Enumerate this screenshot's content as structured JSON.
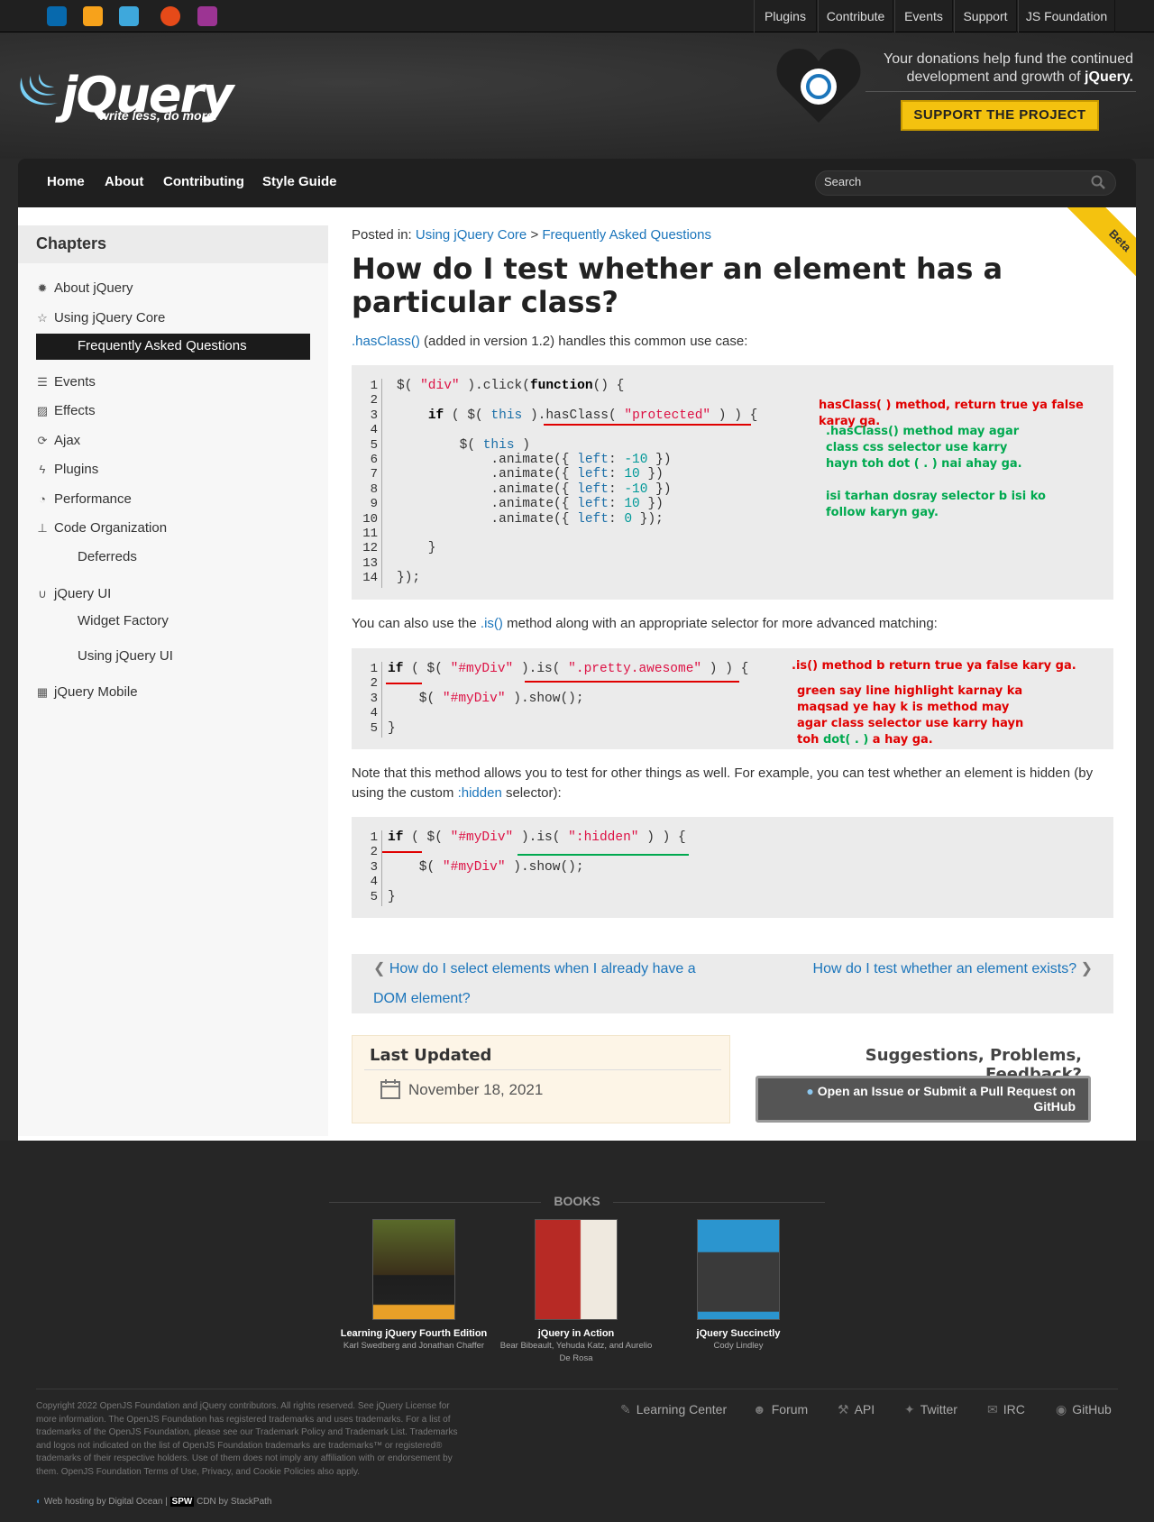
{
  "topbar": {
    "sites": [
      "jquery-icon",
      "jquery-ui-icon",
      "jquery-mobile-icon",
      "sizzle-icon",
      "qunit-icon"
    ],
    "links": [
      "Plugins",
      "Contribute",
      "Events",
      "Support",
      "JS Foundation"
    ]
  },
  "header": {
    "logo_text": "jQuery",
    "tagline": "write less, do more.",
    "donate_text": "Your donations help fund the continued development and growth of",
    "donate_brand": "jQuery.",
    "support_button": "SUPPORT THE PROJECT"
  },
  "nav": {
    "items": [
      "Home",
      "About",
      "Contributing",
      "Style Guide"
    ],
    "search_label": "Search"
  },
  "sidebar": {
    "heading": "Chapters",
    "items": [
      {
        "label": "About jQuery",
        "icon": "gear-icon"
      },
      {
        "label": "Using jQuery Core",
        "icon": "star-icon"
      },
      {
        "label": "Frequently Asked Questions",
        "icon": "",
        "active": true
      },
      {
        "label": "Events",
        "icon": "list-icon"
      },
      {
        "label": "Effects",
        "icon": "image-icon"
      },
      {
        "label": "Ajax",
        "icon": "refresh-icon"
      },
      {
        "label": "Plugins",
        "icon": "bolt-icon"
      },
      {
        "label": "Performance",
        "icon": "dashboard-icon"
      },
      {
        "label": "Code Organization",
        "icon": "sitemap-icon"
      },
      {
        "label": "Deferreds",
        "icon": ""
      },
      {
        "label": "jQuery UI",
        "icon": "magnet-icon"
      },
      {
        "label": "Widget Factory",
        "icon": ""
      },
      {
        "label": "Using jQuery UI",
        "icon": ""
      },
      {
        "label": "jQuery Mobile",
        "icon": "grid-icon"
      }
    ]
  },
  "ribbon": "Beta",
  "article": {
    "posted_in_label": "Posted in:",
    "crumb1": "Using jQuery Core",
    "crumb_sep": ">",
    "crumb2": "Frequently Asked Questions",
    "title": "How do I test whether an element has a particular class?",
    "intro_link": ".hasClass()",
    "intro_rest": "(added in version 1.2) handles this common use case:",
    "para2_a": "You can also use the",
    "para2_link": ".is()",
    "para2_b": "method along with an appropriate selector for more advanced matching:",
    "para3_a": "Note that this method allows you to test for other things as well. For example, you can test whether an element is hidden (by using the custom",
    "para3_link": ":hidden",
    "para3_b": "selector):"
  },
  "notes": {
    "n1": "hasClass( ) method,  return true ya false karay ga.",
    "n2": ".hasClass() method may agar class css selector use karry hayn toh dot ( . ) nai ahay ga.",
    "n3": "isi tarhan dosray selector b isi ko follow karyn gay.",
    "n4": ".is() method b return true ya false kary ga.",
    "n5a": "green say line highlight karnay ka maqsad ye hay k is method may agar class selector use karry hayn toh",
    "n5b": "dot( . )",
    "n5c": "a hay ga."
  },
  "pager": {
    "prev": "How do I select elements when I already have a DOM element?",
    "next": "How do I test whether an element exists?"
  },
  "last_updated": {
    "title": "Last Updated",
    "date": "November 18, 2021"
  },
  "feedback": {
    "title": "Suggestions, Problems, Feedback?",
    "button": "Open an Issue or Submit a Pull Request on GitHub"
  },
  "books": {
    "heading": "BOOKS",
    "items": [
      {
        "title": "Learning jQuery Fourth Edition",
        "authors": "Karl Swedberg and Jonathan Chaffer",
        "color": "#4a3a1e"
      },
      {
        "title": "jQuery in Action",
        "authors": "Bear Bibeault, Yehuda Katz, and Aurelio De Rosa",
        "color": "#b72a25"
      },
      {
        "title": "jQuery Succinctly",
        "authors": "Cody Lindley",
        "color": "#2b95cf"
      }
    ]
  },
  "footer": {
    "copyright": "Copyright 2022 OpenJS Foundation and jQuery contributors. All rights reserved. See jQuery License for more information. The OpenJS Foundation has registered trademarks and uses trademarks. For a list of trademarks of the OpenJS Foundation, please see our Trademark Policy and Trademark List. Trademarks and logos not indicated on the list of OpenJS Foundation trademarks are trademarks™ or registered® trademarks of their respective holders. Use of them does not imply any affiliation with or endorsement by them. OpenJS Foundation Terms of Use, Privacy, and Cookie Policies also apply.",
    "links": [
      "Learning Center",
      "Forum",
      "API",
      "Twitter",
      "IRC",
      "GitHub"
    ],
    "hosting": "Web hosting by Digital Ocean",
    "cdn_badge": "SPW",
    "cdn": "CDN by StackPath"
  }
}
